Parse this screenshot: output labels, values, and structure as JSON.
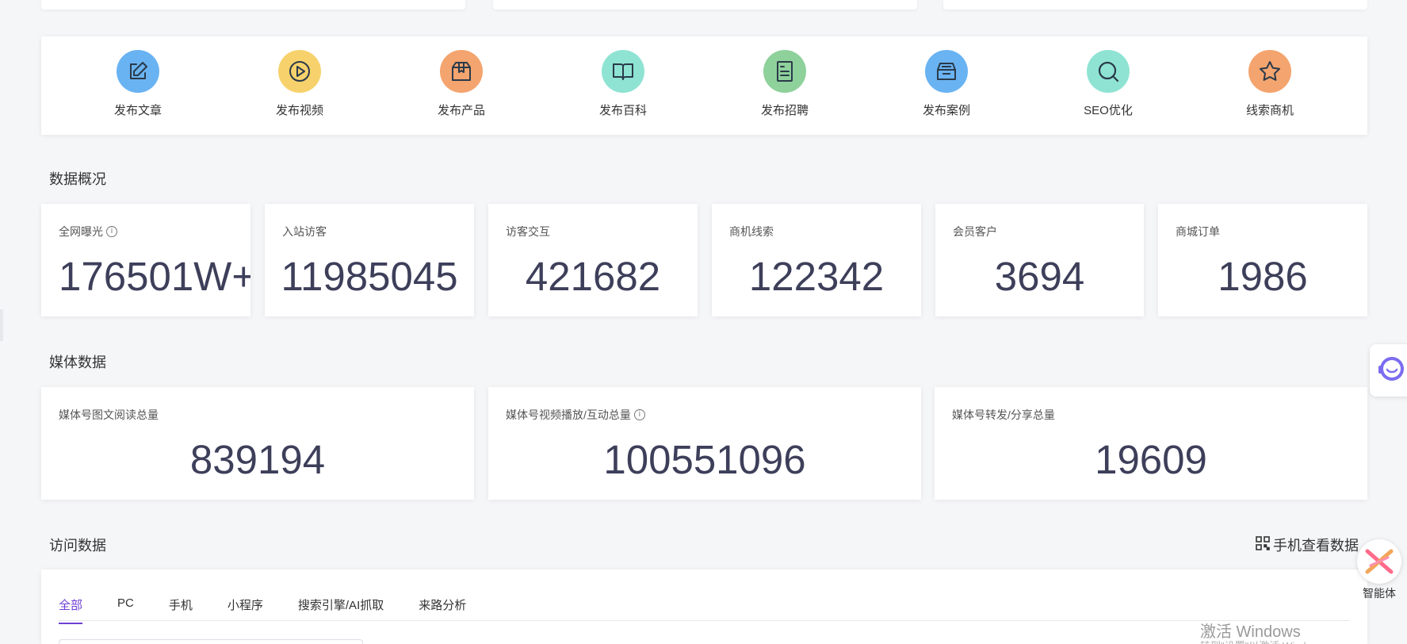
{
  "colors": {
    "accent": "#6f3fd6",
    "value_text": "#3d3f5a",
    "icon_blue": "#6ab3f2",
    "icon_yellow": "#f7d26c",
    "icon_orange": "#f4a46e",
    "icon_teal": "#8fe3d3",
    "icon_green": "#8fd19b"
  },
  "quick_actions": [
    {
      "label": "发布文章",
      "icon": "edit-icon",
      "color": "#6ab3f2"
    },
    {
      "label": "发布视频",
      "icon": "play-icon",
      "color": "#f7d26c"
    },
    {
      "label": "发布产品",
      "icon": "box-icon",
      "color": "#f4a46e"
    },
    {
      "label": "发布百科",
      "icon": "book-icon",
      "color": "#8fe3d3"
    },
    {
      "label": "发布招聘",
      "icon": "document-icon",
      "color": "#8fd19b"
    },
    {
      "label": "发布案例",
      "icon": "inbox-icon",
      "color": "#6ab3f2"
    },
    {
      "label": "SEO优化",
      "icon": "search-icon",
      "color": "#8fe3d3"
    },
    {
      "label": "线索商机",
      "icon": "star-icon",
      "color": "#f4a46e"
    }
  ],
  "overview": {
    "title": "数据概况",
    "stats": [
      {
        "label": "全网曝光",
        "value": "176501W+",
        "info": true
      },
      {
        "label": "入站访客",
        "value": "11985045"
      },
      {
        "label": "访客交互",
        "value": "421682"
      },
      {
        "label": "商机线索",
        "value": "122342"
      },
      {
        "label": "会员客户",
        "value": "3694"
      },
      {
        "label": "商城订单",
        "value": "1986"
      }
    ]
  },
  "media": {
    "title": "媒体数据",
    "stats": [
      {
        "label": "媒体号图文阅读总量",
        "value": "839194"
      },
      {
        "label": "媒体号视频播放/互动总量",
        "value": "100551096",
        "info": true
      },
      {
        "label": "媒体号转发/分享总量",
        "value": "19609"
      }
    ]
  },
  "visits": {
    "title": "访问数据",
    "mobile_link": "手机查看数据",
    "tabs": [
      "全部",
      "PC",
      "手机",
      "小程序",
      "搜索引擎/AI抓取",
      "来路分析"
    ],
    "active_tab": 0
  },
  "floating": {
    "agent_label": "智能体"
  },
  "watermark": {
    "title": "激活 Windows",
    "sub": "转到\"设置\"以激活 Windows。"
  }
}
